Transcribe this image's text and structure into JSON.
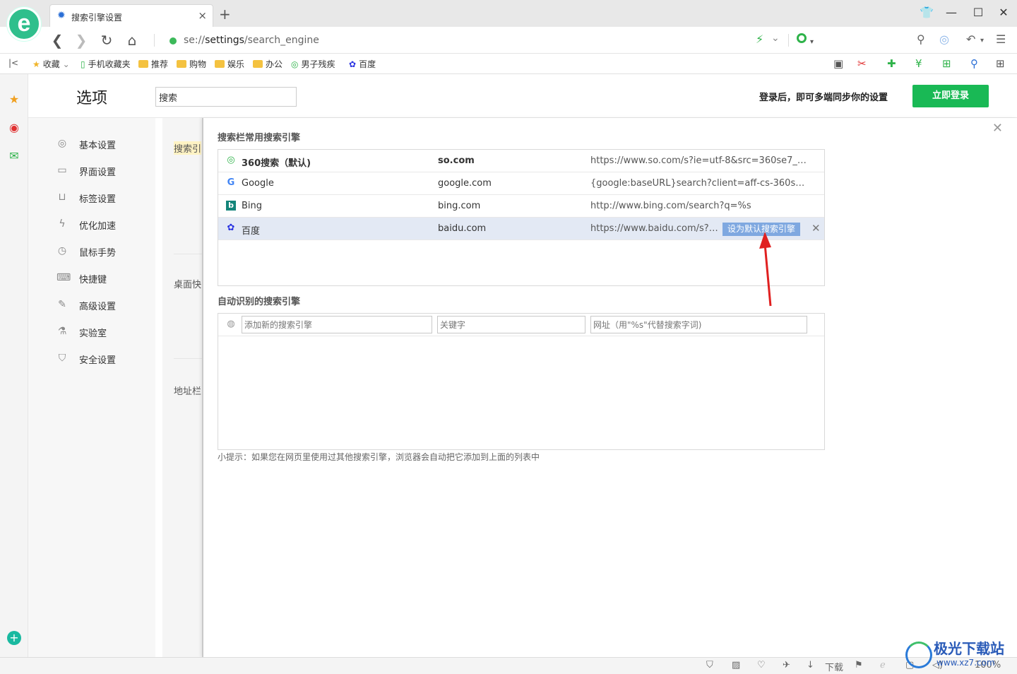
{
  "browser": {
    "tab_title": "搜索引擎设置",
    "tab_close": "×",
    "new_tab": "+",
    "url_prefix": "se://",
    "url_bold": "settings",
    "url_suffix": "/search_engine"
  },
  "bookmarks": [
    {
      "label": "收藏",
      "icon": "star-icon"
    },
    {
      "label": "手机收藏夹",
      "icon": "phone-icon"
    },
    {
      "label": "推荐",
      "icon": "folder-icon"
    },
    {
      "label": "购物",
      "icon": "folder-icon"
    },
    {
      "label": "娱乐",
      "icon": "folder-icon"
    },
    {
      "label": "办公",
      "icon": "folder-icon"
    },
    {
      "label": "男子残疾",
      "icon": "360-search-icon"
    },
    {
      "label": "百度",
      "icon": "baidu-paw-icon"
    }
  ],
  "options": {
    "title": "选项",
    "search_value": "搜索",
    "login_tip": "登录后，即可多端同步你的设置",
    "login_button": "立即登录"
  },
  "sidebar": {
    "items": [
      {
        "label": "基本设置",
        "icon": "settings-circle-icon"
      },
      {
        "label": "界面设置",
        "icon": "window-icon"
      },
      {
        "label": "标签设置",
        "icon": "tab-icon"
      },
      {
        "label": "优化加速",
        "icon": "lightning-icon"
      },
      {
        "label": "鼠标手势",
        "icon": "mouse-icon"
      },
      {
        "label": "快捷键",
        "icon": "keyboard-icon"
      },
      {
        "label": "高级设置",
        "icon": "wrench-icon"
      },
      {
        "label": "实验室",
        "icon": "flask-icon"
      },
      {
        "label": "安全设置",
        "icon": "shield-icon"
      }
    ]
  },
  "background_labels": [
    "搜索引",
    "桌面快",
    "地址栏"
  ],
  "modal": {
    "section1_title": "搜索栏常用搜索引擎",
    "engines": [
      {
        "name": "360搜索（默认)",
        "keyword": "so.com",
        "url": "https://www.so.com/s?ie=utf-8&src=360se7_ad...",
        "icon": "360-search-icon"
      },
      {
        "name": "Google",
        "keyword": "google.com",
        "url": "{google:baseURL}search?client=aff-cs-360se&ie...",
        "icon": "google-icon"
      },
      {
        "name": "Bing",
        "keyword": "bing.com",
        "url": "http://www.bing.com/search?q=%s",
        "icon": "bing-icon"
      },
      {
        "name": "百度",
        "keyword": "baidu.com",
        "url": "https://www.baidu.com/s?w...",
        "icon": "baidu-paw-icon"
      }
    ],
    "set_default_label": "设为默认搜索引擎",
    "delete_label": "✕",
    "section2_title": "自动识别的搜索引擎",
    "add_placeholders": {
      "name": "添加新的搜索引擎",
      "keyword": "关键字",
      "url": "网址（用\"%s\"代替搜索字词)"
    },
    "tip": "小提示：如果您在网页里使用过其他搜索引擎，浏览器会自动把它添加到上面的列表中"
  },
  "statusbar": {
    "download_label": "下载",
    "zoom": "100%"
  },
  "watermark": {
    "title": "极光下载站",
    "sub": "www.xz7.com"
  },
  "colors": {
    "accent_green": "#19b955",
    "selected_row": "#e3e9f4",
    "set_default_bg": "#7fa8e0",
    "annotation_arrow": "#e02020"
  }
}
